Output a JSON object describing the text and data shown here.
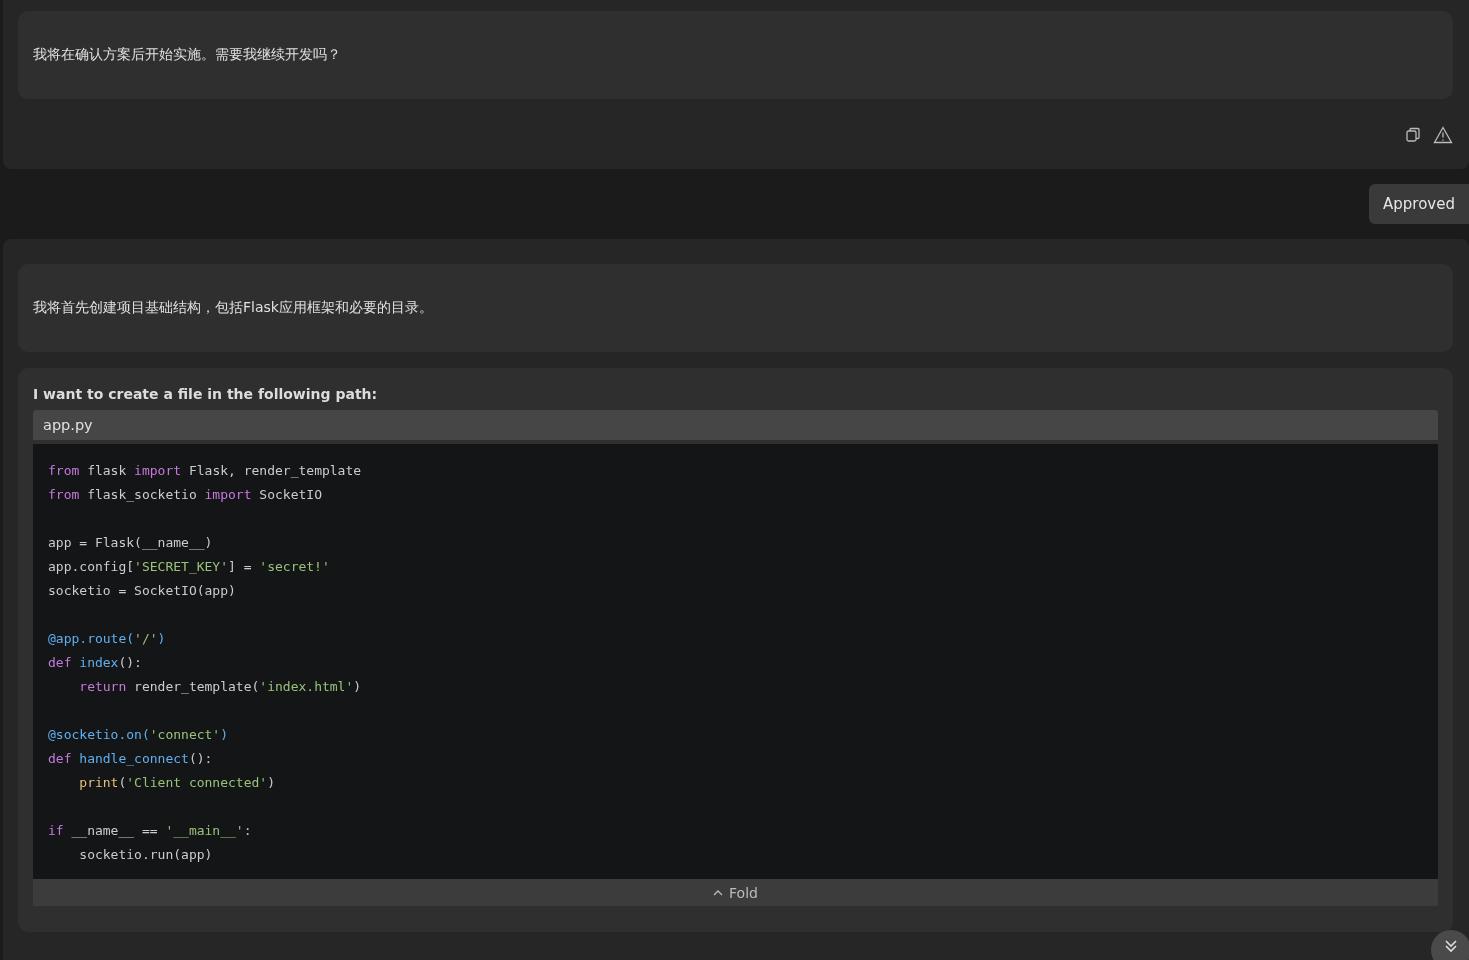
{
  "messages": [
    {
      "text": "我将在确认方案后开始实施。需要我继续开发吗？"
    }
  ],
  "actions": [
    {
      "kind": "copy"
    },
    {
      "kind": "report"
    }
  ],
  "approval": {
    "label": "Approved"
  },
  "reply": {
    "text": "我将首先创建项目基础结构，包括Flask应用框架和必要的目录。"
  },
  "file_request": {
    "title": "I want to create a file in the following path:",
    "path": "app.py",
    "fold_label": "Fold",
    "code": [
      {
        "kind": "code",
        "tokens": [
          {
            "kind": "keyword",
            "text": "from"
          },
          {
            "kind": "plain",
            "text": " flask "
          },
          {
            "kind": "keyword",
            "text": "import"
          },
          {
            "kind": "plain",
            "text": " Flask, render_template"
          }
        ]
      },
      {
        "kind": "code",
        "tokens": [
          {
            "kind": "keyword",
            "text": "from"
          },
          {
            "kind": "plain",
            "text": " flask_socketio "
          },
          {
            "kind": "keyword",
            "text": "import"
          },
          {
            "kind": "plain",
            "text": " SocketIO"
          }
        ]
      },
      {
        "kind": "blank"
      },
      {
        "kind": "code",
        "tokens": [
          {
            "kind": "plain",
            "text": "app = Flask(__name__)"
          }
        ]
      },
      {
        "kind": "code",
        "tokens": [
          {
            "kind": "plain",
            "text": "app.config["
          },
          {
            "kind": "string",
            "text": "'SECRET_KEY'"
          },
          {
            "kind": "plain",
            "text": "] = "
          },
          {
            "kind": "string",
            "text": "'secret!'"
          }
        ]
      },
      {
        "kind": "code",
        "tokens": [
          {
            "kind": "plain",
            "text": "socketio = SocketIO(app)"
          }
        ]
      },
      {
        "kind": "blank"
      },
      {
        "kind": "code",
        "tokens": [
          {
            "kind": "decorator",
            "text": "@app.route("
          },
          {
            "kind": "string",
            "text": "'/'"
          },
          {
            "kind": "decorator",
            "text": ")"
          }
        ]
      },
      {
        "kind": "code",
        "tokens": [
          {
            "kind": "keyword",
            "text": "def"
          },
          {
            "kind": "function",
            "text": " index"
          },
          {
            "kind": "plain",
            "text": "():"
          }
        ]
      },
      {
        "kind": "code",
        "tokens": [
          {
            "kind": "keyword",
            "text": "    return"
          },
          {
            "kind": "plain",
            "text": " render_template("
          },
          {
            "kind": "string",
            "text": "'index.html'"
          },
          {
            "kind": "plain",
            "text": ")"
          }
        ]
      },
      {
        "kind": "blank"
      },
      {
        "kind": "code",
        "tokens": [
          {
            "kind": "decorator",
            "text": "@socketio.on("
          },
          {
            "kind": "string",
            "text": "'connect'"
          },
          {
            "kind": "decorator",
            "text": ")"
          }
        ]
      },
      {
        "kind": "code",
        "tokens": [
          {
            "kind": "keyword",
            "text": "def"
          },
          {
            "kind": "function",
            "text": " handle_connect"
          },
          {
            "kind": "plain",
            "text": "():"
          }
        ]
      },
      {
        "kind": "code",
        "tokens": [
          {
            "kind": "builtin",
            "text": "    print"
          },
          {
            "kind": "plain",
            "text": "("
          },
          {
            "kind": "string",
            "text": "'Client connected'"
          },
          {
            "kind": "plain",
            "text": ")"
          }
        ]
      },
      {
        "kind": "blank"
      },
      {
        "kind": "code",
        "tokens": [
          {
            "kind": "keyword",
            "text": "if"
          },
          {
            "kind": "plain",
            "text": " __name__ == "
          },
          {
            "kind": "string",
            "text": "'__main__'"
          },
          {
            "kind": "plain",
            "text": ":"
          }
        ]
      },
      {
        "kind": "code",
        "tokens": [
          {
            "kind": "plain",
            "text": "    socketio.run(app)"
          }
        ]
      }
    ]
  }
}
